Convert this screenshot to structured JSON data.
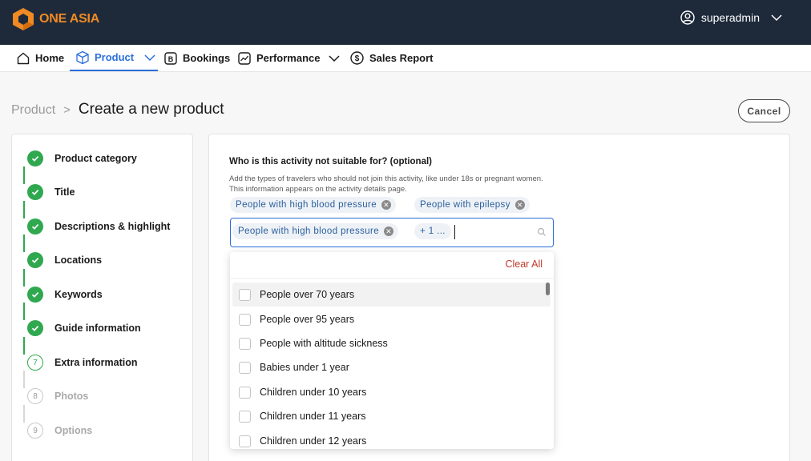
{
  "brand": {
    "name": "ONE ASIA",
    "accent": "#f08a24",
    "topbar_bg": "#1e2a3a"
  },
  "user": {
    "name": "superadmin"
  },
  "nav": {
    "items": [
      {
        "label": "Home",
        "icon": "home-icon"
      },
      {
        "label": "Product",
        "icon": "box-icon",
        "active": true
      },
      {
        "label": "Bookings",
        "icon": "bookings-icon"
      },
      {
        "label": "Performance",
        "icon": "chart-icon"
      },
      {
        "label": "Sales Report",
        "icon": "dollar-icon"
      }
    ]
  },
  "breadcrumb": {
    "parent": "Product",
    "separator": ">",
    "title": "Create a new product"
  },
  "header": {
    "cancel_label": "Cancel"
  },
  "steps": [
    {
      "label": "Product category",
      "state": "done"
    },
    {
      "label": "Title",
      "state": "done"
    },
    {
      "label": "Descriptions & highlight",
      "state": "done"
    },
    {
      "label": "Locations",
      "state": "done"
    },
    {
      "label": "Keywords",
      "state": "done"
    },
    {
      "label": "Guide information",
      "state": "done"
    },
    {
      "label": "Extra information",
      "state": "current",
      "number": "7"
    },
    {
      "label": "Photos",
      "state": "todo",
      "number": "8"
    },
    {
      "label": "Options",
      "state": "todo",
      "number": "9"
    }
  ],
  "question": {
    "title": "Who is this activity not suitable for? (optional)",
    "help_line1": "Add the types of travelers who should not join this activity, like under 18s or pregnant women.",
    "help_line2": "This information appears on the activity details page.",
    "selected_chips": [
      "People with high blood pressure",
      "People with epilepsy"
    ],
    "input_chip": "People with high blood pressure",
    "more_chip": "+ 1 ..."
  },
  "dropdown": {
    "clear_all_label": "Clear All",
    "options": [
      "People over 70 years",
      "People over 95 years",
      "People with altitude sickness",
      "Babies under 1 year",
      "Children under 10 years",
      "Children under 11 years",
      "Children under 12 years"
    ]
  }
}
